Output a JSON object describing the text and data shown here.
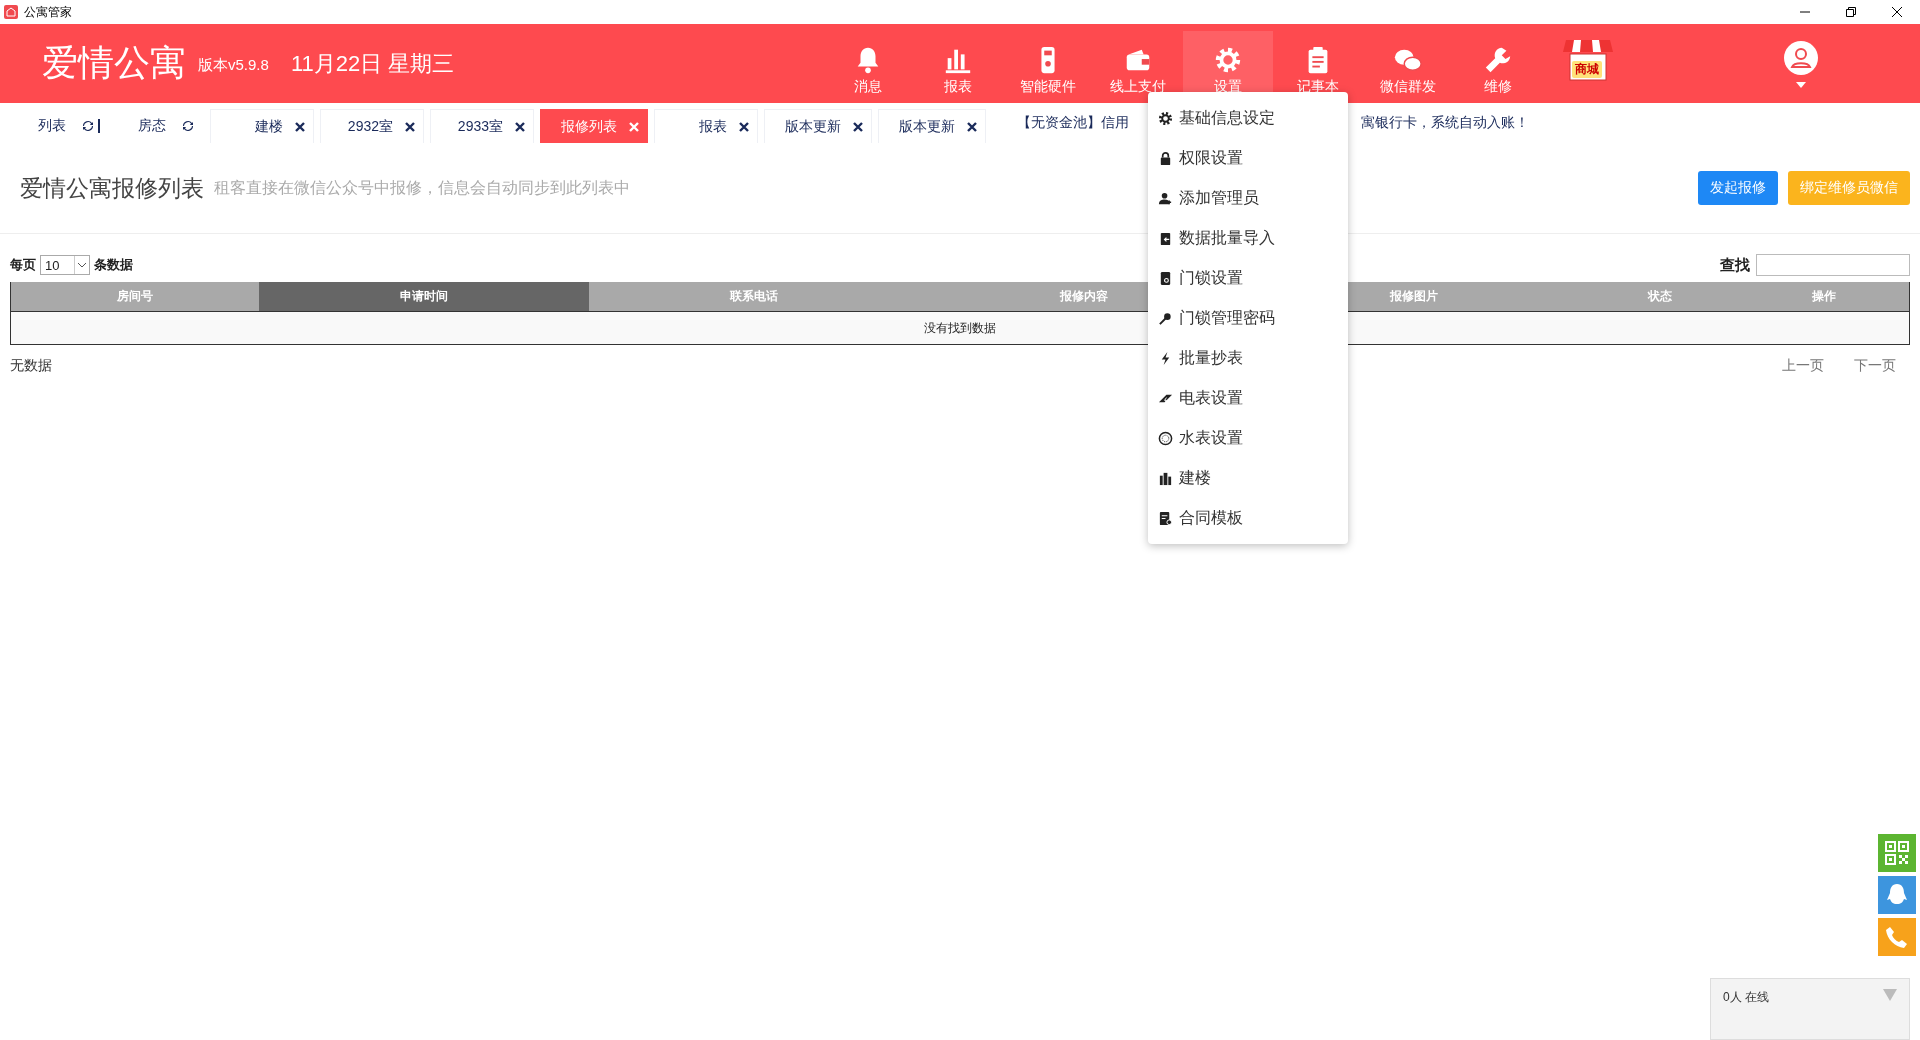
{
  "window": {
    "title": "公寓管家"
  },
  "header": {
    "logo": "爱情公寓",
    "version": "版本v5.9.8",
    "date": "11月22日 星期三"
  },
  "nav": [
    {
      "kind": "bell",
      "label": "消息",
      "selected": false
    },
    {
      "kind": "chart",
      "label": "报表",
      "selected": false
    },
    {
      "kind": "device",
      "label": "智能硬件",
      "selected": false
    },
    {
      "kind": "wallet",
      "label": "线上支付",
      "selected": false
    },
    {
      "kind": "gear",
      "label": "设置",
      "selected": true
    },
    {
      "kind": "clipboard",
      "label": "记事本",
      "selected": false
    },
    {
      "kind": "chat",
      "label": "微信群发",
      "selected": false
    },
    {
      "kind": "wrench",
      "label": "维修",
      "selected": false
    },
    {
      "kind": "shop",
      "label": "商城",
      "selected": false
    }
  ],
  "tabs": [
    {
      "kind": "fixed",
      "label": "列表",
      "selected": false
    },
    {
      "kind": "fixed",
      "label": "房态",
      "selected": false
    },
    {
      "kind": "closable",
      "label": "建楼",
      "selected": false
    },
    {
      "kind": "closable",
      "label": "2932室",
      "selected": false
    },
    {
      "kind": "closable",
      "label": "2933室",
      "selected": false
    },
    {
      "kind": "closable",
      "label": "报修列表",
      "selected": true
    },
    {
      "kind": "closable",
      "label": "报表",
      "selected": false
    },
    {
      "kind": "closable",
      "label": "版本更新",
      "selected": false
    },
    {
      "kind": "closable",
      "label": "版本更新",
      "selected": false
    }
  ],
  "ticker": [
    "【无资金池】信用",
    "寓银行卡，系统自动入账！"
  ],
  "page": {
    "title": "爱情公寓报修列表",
    "subtitle": "租客直接在微信公众号中报修，信息会自动同步到此列表中",
    "buttons": [
      {
        "kind": "primary",
        "label": "发起报修"
      },
      {
        "kind": "warning",
        "label": "绑定维修员微信"
      }
    ]
  },
  "table": {
    "per_page_label": "每页",
    "page_size": "10",
    "per_page_suffix": "条数据",
    "search_label": "查找",
    "columns": [
      {
        "label": "房间号",
        "selected": false
      },
      {
        "label": "申请时间",
        "selected": true
      },
      {
        "label": "联系电话",
        "selected": false
      },
      {
        "label": "报修内容",
        "selected": false
      },
      {
        "label": "报修图片",
        "selected": false
      },
      {
        "label": "状态",
        "selected": false
      },
      {
        "label": "操作",
        "selected": false
      }
    ],
    "empty_message": "没有找到数据",
    "info": "无数据",
    "prev": "上一页",
    "next": "下一页"
  },
  "settings_menu": [
    {
      "kind": "gear",
      "label": "基础信息设定"
    },
    {
      "kind": "lock",
      "label": "权限设置"
    },
    {
      "kind": "user-add",
      "label": "添加管理员"
    },
    {
      "kind": "import",
      "label": "数据批量导入"
    },
    {
      "kind": "door-lock",
      "label": "门锁设置"
    },
    {
      "kind": "key",
      "label": "门锁管理密码"
    },
    {
      "kind": "bolt",
      "label": "批量抄表"
    },
    {
      "kind": "meter",
      "label": "电表设置"
    },
    {
      "kind": "dial",
      "label": "水表设置"
    },
    {
      "kind": "building",
      "label": "建楼"
    },
    {
      "kind": "contract",
      "label": "合同模板"
    }
  ],
  "side_buttons": [
    {
      "kind": "qr"
    },
    {
      "kind": "qq"
    },
    {
      "kind": "phone"
    }
  ],
  "online": {
    "label": "0人 在线"
  }
}
